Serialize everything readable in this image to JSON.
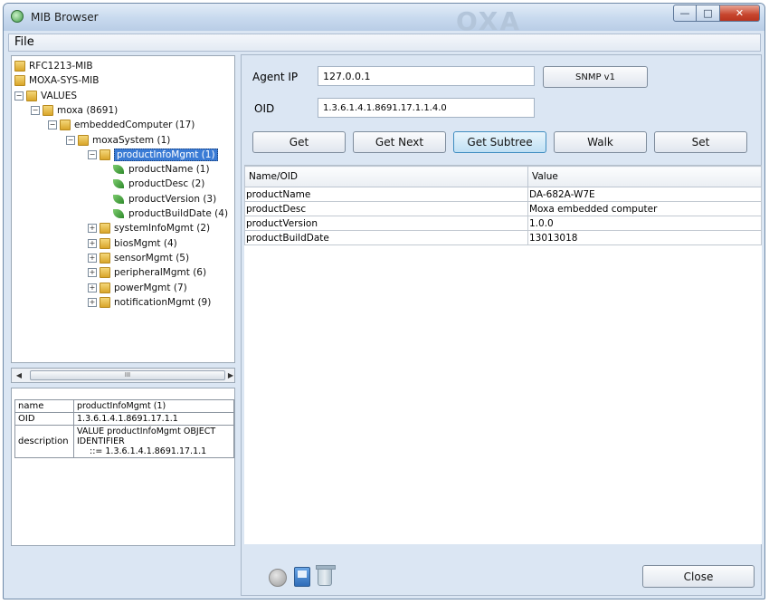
{
  "window": {
    "title": "MIB Browser",
    "brand_text": "OXA",
    "controls": {
      "minimize": "—",
      "maximize": "□",
      "close": "✕"
    }
  },
  "menu": {
    "file": "File"
  },
  "tree": {
    "nodes": [
      {
        "label": "RFC1213-MIB",
        "type": "folder",
        "level": 0,
        "expander": ""
      },
      {
        "label": "MOXA-SYS-MIB",
        "type": "folder",
        "level": 0,
        "expander": ""
      },
      {
        "label": "VALUES",
        "type": "folder",
        "level": 0,
        "expander": "−"
      },
      {
        "label": "moxa (8691)",
        "type": "folder",
        "level": 1,
        "expander": "−"
      },
      {
        "label": "embeddedComputer (17)",
        "type": "folder",
        "level": 2,
        "expander": "−"
      },
      {
        "label": "moxaSystem (1)",
        "type": "folder",
        "level": 3,
        "expander": "−"
      },
      {
        "label": "productInfoMgmt (1)",
        "type": "folder",
        "level": 4,
        "expander": "−",
        "selected": true
      },
      {
        "label": "productName (1)",
        "type": "leaf",
        "level": 5
      },
      {
        "label": "productDesc (2)",
        "type": "leaf",
        "level": 5
      },
      {
        "label": "productVersion (3)",
        "type": "leaf",
        "level": 5
      },
      {
        "label": "productBuildDate (4)",
        "type": "leaf",
        "level": 5
      },
      {
        "label": "systemInfoMgmt (2)",
        "type": "folder",
        "level": 4,
        "expander": "+"
      },
      {
        "label": "biosMgmt (4)",
        "type": "folder",
        "level": 4,
        "expander": "+"
      },
      {
        "label": "sensorMgmt (5)",
        "type": "folder",
        "level": 4,
        "expander": "+"
      },
      {
        "label": "peripheralMgmt (6)",
        "type": "folder",
        "level": 4,
        "expander": "+"
      },
      {
        "label": "powerMgmt (7)",
        "type": "folder",
        "level": 4,
        "expander": "+"
      },
      {
        "label": "notificationMgmt (9)",
        "type": "folder",
        "level": 4,
        "expander": "+"
      }
    ]
  },
  "scrollbar": {
    "left_arrow": "◀",
    "right_arrow": "▶",
    "thumb_grip": "III"
  },
  "properties": {
    "rows": [
      {
        "key": "name",
        "value": "productInfoMgmt (1)"
      },
      {
        "key": "OID",
        "value": "1.3.6.1.4.1.8691.17.1.1"
      },
      {
        "key": "description",
        "value_line1": "VALUE productInfoMgmt OBJECT",
        "value_line2": "IDENTIFIER",
        "value_line3": "::= 1.3.6.1.4.1.8691.17.1.1"
      }
    ]
  },
  "agent": {
    "ip_label": "Agent IP",
    "ip_value": "127.0.0.1",
    "snmp_button": "SNMP v1",
    "oid_label": "OID",
    "oid_value": "1.3.6.1.4.1.8691.17.1.1.4.0"
  },
  "actions": {
    "get": "Get",
    "get_next": "Get Next",
    "get_subtree": "Get Subtree",
    "walk": "Walk",
    "set": "Set"
  },
  "results": {
    "headers": {
      "name": "Name/OID",
      "value": "Value"
    },
    "rows": [
      {
        "name": "productName",
        "value": "DA-682A-W7E"
      },
      {
        "name": "productDesc",
        "value": "Moxa embedded computer"
      },
      {
        "name": "productVersion",
        "value": "1.0.0"
      },
      {
        "name": "productBuildDate",
        "value": "13013018"
      }
    ]
  },
  "footer": {
    "close_label": "Close"
  }
}
